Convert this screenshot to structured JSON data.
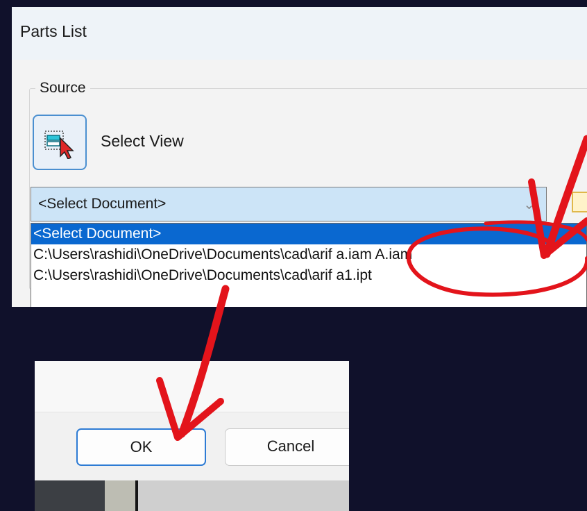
{
  "dialog": {
    "title": "Parts List",
    "source_legend": "Source",
    "select_view_label": "Select View",
    "document_combo": {
      "value": "<Select Document>"
    },
    "dropdown_options": [
      "<Select Document>",
      "C:\\Users\\rashidi\\OneDrive\\Documents\\cad\\arif a.iam A.iam",
      "C:\\Users\\rashidi\\OneDrive\\Documents\\cad\\arif a1.ipt"
    ],
    "dropdown_selected_index": 0
  },
  "footer": {
    "ok_label": "OK",
    "cancel_label": "Cancel"
  },
  "colors": {
    "background": "#10112b",
    "selection": "#0a68d0",
    "annotation_red": "#e3141b",
    "focus_border": "#2d7bd4"
  },
  "icons": {
    "select_view": "select-view-icon",
    "combo_dropdown": "chevron-down-icon"
  }
}
